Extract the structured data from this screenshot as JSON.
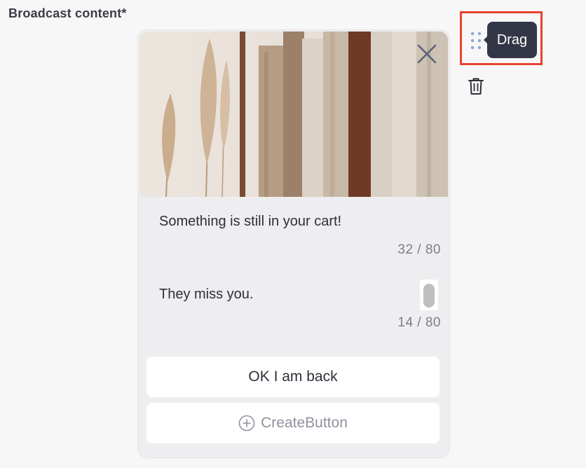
{
  "section": {
    "label": "Broadcast content*"
  },
  "message": {
    "image": {
      "description": "clothing-rack-photo"
    },
    "title_text": "Something is still in your cart!",
    "title_counter": "32 / 80",
    "body_text": "They miss you.",
    "body_counter": "14 / 80"
  },
  "buttons": {
    "primary_label": "OK I am back",
    "create_label": "CreateButton"
  },
  "controls": {
    "drag_tooltip": "Drag"
  },
  "icons": {
    "close": "close-icon",
    "drag": "drag-handle-icon",
    "trash": "trash-icon",
    "plus": "plus-circle-icon"
  },
  "colors": {
    "highlight": "#e8432e",
    "tooltip_bg": "#323647",
    "drag_dots": "#8aa4dc"
  }
}
